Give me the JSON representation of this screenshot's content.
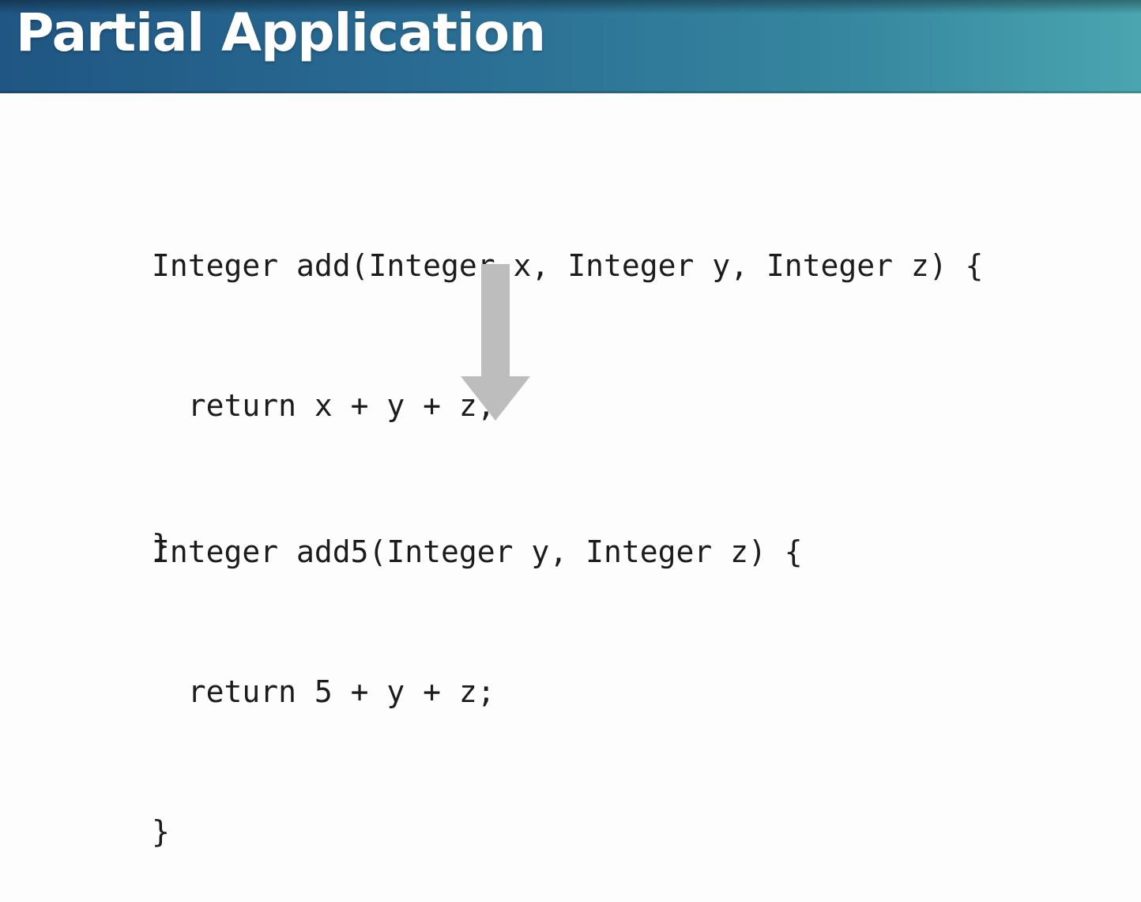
{
  "slide": {
    "title": "Partial Application"
  },
  "code_before": {
    "lines": [
      "Integer add(Integer x, Integer y, Integer z) {",
      "  return x + y + z;",
      "}"
    ]
  },
  "code_after": {
    "lines": [
      "Integer add5(Integer y, Integer z) {",
      "  return 5 + y + z;",
      "}"
    ]
  },
  "colors": {
    "header_start": "#1f5683",
    "header_end": "#4aa5b0",
    "arrow": "#bdbdbd",
    "code_text": "#1c1c1c",
    "background": "#fdfdfd"
  },
  "icons": {
    "transform_arrow": "down-arrow-icon"
  }
}
